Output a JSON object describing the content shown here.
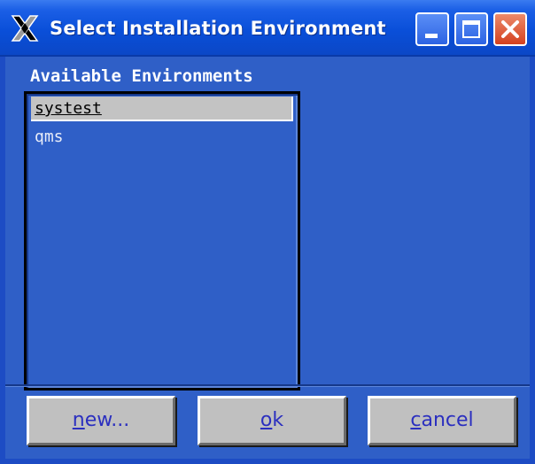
{
  "window": {
    "title": "Select Installation Environment",
    "icon": "x-window-icon",
    "controls": {
      "minimize": "minimize-icon",
      "maximize": "maximize-icon",
      "close": "close-icon"
    }
  },
  "main": {
    "heading": "Available Environments",
    "environments": [
      {
        "label": "systest",
        "selected": true
      },
      {
        "label": "qms",
        "selected": false
      }
    ]
  },
  "buttons": {
    "new": {
      "mnemonic": "n",
      "rest": "ew..."
    },
    "ok": {
      "mnemonic": "o",
      "rest": "k"
    },
    "cancel": {
      "mnemonic": "c",
      "rest": "ancel"
    }
  },
  "colors": {
    "titlebar": "#0a4fd9",
    "window_body": "#2f5fc7",
    "selection": "#c3c3c3",
    "button_face": "#c0c0c0",
    "button_text": "#2b2fbf",
    "close_button": "#d4411f"
  }
}
